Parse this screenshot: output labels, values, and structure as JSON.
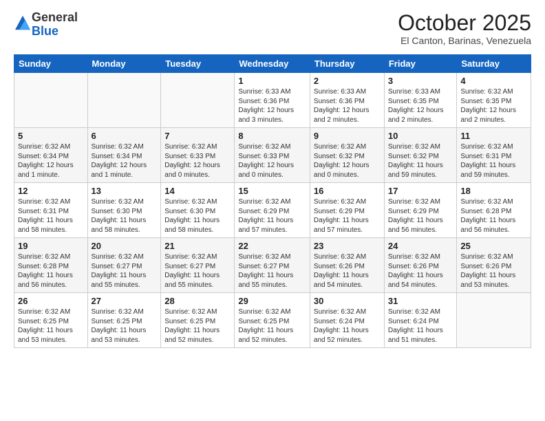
{
  "header": {
    "logo_general": "General",
    "logo_blue": "Blue",
    "month_title": "October 2025",
    "location": "El Canton, Barinas, Venezuela"
  },
  "weekdays": [
    "Sunday",
    "Monday",
    "Tuesday",
    "Wednesday",
    "Thursday",
    "Friday",
    "Saturday"
  ],
  "weeks": [
    [
      {
        "day": "",
        "info": ""
      },
      {
        "day": "",
        "info": ""
      },
      {
        "day": "",
        "info": ""
      },
      {
        "day": "1",
        "info": "Sunrise: 6:33 AM\nSunset: 6:36 PM\nDaylight: 12 hours and 3 minutes."
      },
      {
        "day": "2",
        "info": "Sunrise: 6:33 AM\nSunset: 6:36 PM\nDaylight: 12 hours and 2 minutes."
      },
      {
        "day": "3",
        "info": "Sunrise: 6:33 AM\nSunset: 6:35 PM\nDaylight: 12 hours and 2 minutes."
      },
      {
        "day": "4",
        "info": "Sunrise: 6:32 AM\nSunset: 6:35 PM\nDaylight: 12 hours and 2 minutes."
      }
    ],
    [
      {
        "day": "5",
        "info": "Sunrise: 6:32 AM\nSunset: 6:34 PM\nDaylight: 12 hours and 1 minute."
      },
      {
        "day": "6",
        "info": "Sunrise: 6:32 AM\nSunset: 6:34 PM\nDaylight: 12 hours and 1 minute."
      },
      {
        "day": "7",
        "info": "Sunrise: 6:32 AM\nSunset: 6:33 PM\nDaylight: 12 hours and 0 minutes."
      },
      {
        "day": "8",
        "info": "Sunrise: 6:32 AM\nSunset: 6:33 PM\nDaylight: 12 hours and 0 minutes."
      },
      {
        "day": "9",
        "info": "Sunrise: 6:32 AM\nSunset: 6:32 PM\nDaylight: 12 hours and 0 minutes."
      },
      {
        "day": "10",
        "info": "Sunrise: 6:32 AM\nSunset: 6:32 PM\nDaylight: 11 hours and 59 minutes."
      },
      {
        "day": "11",
        "info": "Sunrise: 6:32 AM\nSunset: 6:31 PM\nDaylight: 11 hours and 59 minutes."
      }
    ],
    [
      {
        "day": "12",
        "info": "Sunrise: 6:32 AM\nSunset: 6:31 PM\nDaylight: 11 hours and 58 minutes."
      },
      {
        "day": "13",
        "info": "Sunrise: 6:32 AM\nSunset: 6:30 PM\nDaylight: 11 hours and 58 minutes."
      },
      {
        "day": "14",
        "info": "Sunrise: 6:32 AM\nSunset: 6:30 PM\nDaylight: 11 hours and 58 minutes."
      },
      {
        "day": "15",
        "info": "Sunrise: 6:32 AM\nSunset: 6:29 PM\nDaylight: 11 hours and 57 minutes."
      },
      {
        "day": "16",
        "info": "Sunrise: 6:32 AM\nSunset: 6:29 PM\nDaylight: 11 hours and 57 minutes."
      },
      {
        "day": "17",
        "info": "Sunrise: 6:32 AM\nSunset: 6:29 PM\nDaylight: 11 hours and 56 minutes."
      },
      {
        "day": "18",
        "info": "Sunrise: 6:32 AM\nSunset: 6:28 PM\nDaylight: 11 hours and 56 minutes."
      }
    ],
    [
      {
        "day": "19",
        "info": "Sunrise: 6:32 AM\nSunset: 6:28 PM\nDaylight: 11 hours and 56 minutes."
      },
      {
        "day": "20",
        "info": "Sunrise: 6:32 AM\nSunset: 6:27 PM\nDaylight: 11 hours and 55 minutes."
      },
      {
        "day": "21",
        "info": "Sunrise: 6:32 AM\nSunset: 6:27 PM\nDaylight: 11 hours and 55 minutes."
      },
      {
        "day": "22",
        "info": "Sunrise: 6:32 AM\nSunset: 6:27 PM\nDaylight: 11 hours and 55 minutes."
      },
      {
        "day": "23",
        "info": "Sunrise: 6:32 AM\nSunset: 6:26 PM\nDaylight: 11 hours and 54 minutes."
      },
      {
        "day": "24",
        "info": "Sunrise: 6:32 AM\nSunset: 6:26 PM\nDaylight: 11 hours and 54 minutes."
      },
      {
        "day": "25",
        "info": "Sunrise: 6:32 AM\nSunset: 6:26 PM\nDaylight: 11 hours and 53 minutes."
      }
    ],
    [
      {
        "day": "26",
        "info": "Sunrise: 6:32 AM\nSunset: 6:25 PM\nDaylight: 11 hours and 53 minutes."
      },
      {
        "day": "27",
        "info": "Sunrise: 6:32 AM\nSunset: 6:25 PM\nDaylight: 11 hours and 53 minutes."
      },
      {
        "day": "28",
        "info": "Sunrise: 6:32 AM\nSunset: 6:25 PM\nDaylight: 11 hours and 52 minutes."
      },
      {
        "day": "29",
        "info": "Sunrise: 6:32 AM\nSunset: 6:25 PM\nDaylight: 11 hours and 52 minutes."
      },
      {
        "day": "30",
        "info": "Sunrise: 6:32 AM\nSunset: 6:24 PM\nDaylight: 11 hours and 52 minutes."
      },
      {
        "day": "31",
        "info": "Sunrise: 6:32 AM\nSunset: 6:24 PM\nDaylight: 11 hours and 51 minutes."
      },
      {
        "day": "",
        "info": ""
      }
    ]
  ]
}
